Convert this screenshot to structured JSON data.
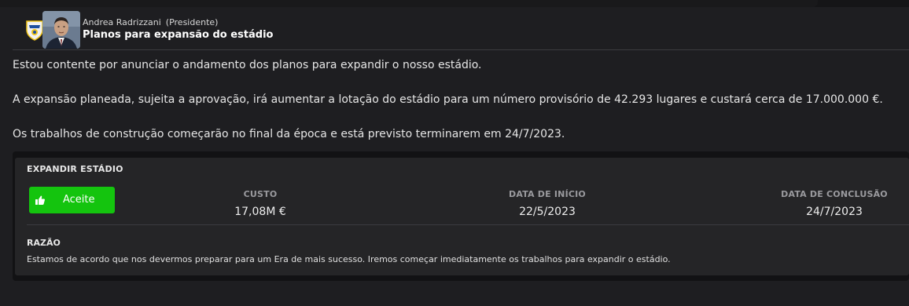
{
  "message": {
    "sender_name": "Andrea Radrizzani",
    "sender_role": "(Presidente)",
    "subject": "Planos para expansão do estádio",
    "paragraphs": [
      "Estou contente por anunciar o andamento dos planos para expandir o nosso estádio.",
      "A expansão planeada, sujeita a aprovação, irá aumentar a lotação do estádio para um número provisório de 42.293 lugares e custará cerca de 17.000.000 €.",
      "Os trabalhos de construção começarão no final da época e está previsto terminarem em 24/7/2023."
    ]
  },
  "expansion": {
    "title": "EXPANDIR ESTÁDIO",
    "accept_label": "Aceite",
    "accept_icon": "thumbs-up-icon",
    "cost_label": "CUSTO",
    "cost_value": "17,08M €",
    "start_label": "DATA DE INÍCIO",
    "start_value": "22/5/2023",
    "end_label": "DATA DE CONCLUSÃO",
    "end_value": "24/7/2023",
    "reason_title": "RAZÃO",
    "reason_text": "Estamos de acordo que nos devermos preparar para um Era de mais sucesso. Iremos começar imediatamente os trabalhos para expandir o estádio."
  },
  "colors": {
    "accept_green": "#14c40e",
    "background": "#1e1e21",
    "card_background": "#252527"
  },
  "icons": {
    "club_crest": "club-crest-icon",
    "avatar": "avatar"
  }
}
